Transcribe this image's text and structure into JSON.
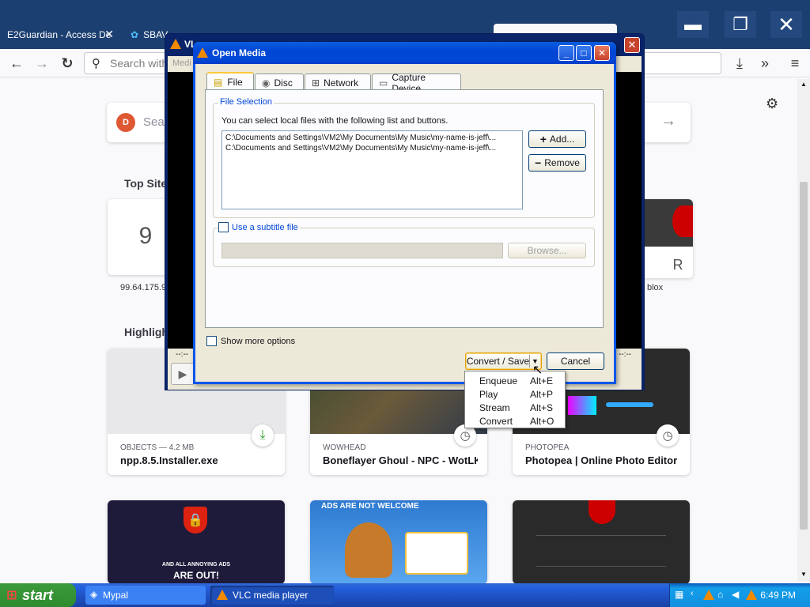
{
  "browser": {
    "tabs": [
      {
        "label": "E2Guardian - Access De"
      },
      {
        "label": "SBAV"
      },
      {
        "label": ""
      },
      {
        "label": ""
      }
    ],
    "url_placeholder": "Search with",
    "search_placeholder": "Sea",
    "top_sites_heading": "Top Site",
    "highlights_heading": "Highligh",
    "top_sites": [
      {
        "tile": "9",
        "label": "99.64.175.9"
      },
      {
        "tile": "R",
        "label": "blox"
      }
    ],
    "highlights": [
      {
        "meta": "OBJECTS — 4.2 MB",
        "title": "npp.8.5.Installer.exe"
      },
      {
        "meta": "WOWHEAD",
        "title": "Boneflayer Ghoul - NPC - WotLK..."
      },
      {
        "meta": "PHOTOPEA",
        "title": "Photopea | Online Photo Editor"
      }
    ],
    "bottom_cards": [
      {
        "title": "ARE OUT!",
        "subtitle": "AND ALL ANNOYING ADS"
      },
      {
        "title": "ADS ARE NOT WELCOME"
      },
      {
        "title": ""
      }
    ]
  },
  "vlc": {
    "title": "VL",
    "media_placeholder": "Medi",
    "time_left": "--:--",
    "time_right": "--:--"
  },
  "dialog": {
    "title": "Open Media",
    "tabs": [
      {
        "label": "File",
        "icon": "file-icon"
      },
      {
        "label": "Disc",
        "icon": "disc-icon"
      },
      {
        "label": "Network",
        "icon": "network-icon"
      },
      {
        "label": "Capture Device",
        "icon": "capture-icon"
      }
    ],
    "file_selection_label": "File Selection",
    "file_selection_hint": "You can select local files with the following list and buttons.",
    "files": [
      "C:\\Documents and Settings\\VM2\\My Documents\\My Music\\my-name-is-jeff\\...",
      "C:\\Documents and Settings\\VM2\\My Documents\\My Music\\my-name-is-jeff\\..."
    ],
    "add_label": "Add...",
    "remove_label": "Remove",
    "subtitle_label": "Use a subtitle file",
    "browse_label": "Browse...",
    "show_more_label": "Show more options",
    "convert_label": "Convert / Save",
    "cancel_label": "Cancel",
    "menu": [
      {
        "label": "Enqueue",
        "shortcut": "Alt+E"
      },
      {
        "label": "Play",
        "shortcut": "Alt+P"
      },
      {
        "label": "Stream",
        "shortcut": "Alt+S"
      },
      {
        "label": "Convert",
        "shortcut": "Alt+O"
      }
    ]
  },
  "taskbar": {
    "start_label": "start",
    "items": [
      {
        "label": "Mypal"
      },
      {
        "label": "VLC media player"
      }
    ],
    "clock": "6:49 PM"
  }
}
